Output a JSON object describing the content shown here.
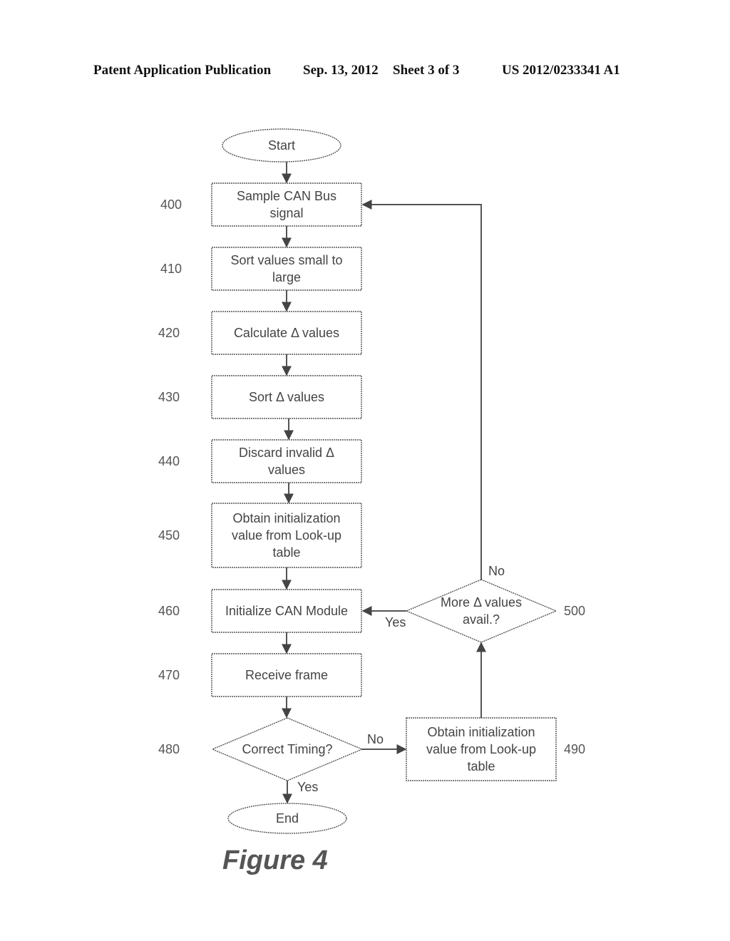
{
  "header": {
    "publication": "Patent Application Publication",
    "date": "Sep. 13, 2012",
    "sheet": "Sheet 3 of 3",
    "number": "US 2012/0233341 A1"
  },
  "figure": {
    "caption": "Figure 4",
    "nodes": [
      {
        "id": "start",
        "type": "terminal",
        "ref": "",
        "lines": [
          "Start"
        ]
      },
      {
        "id": "n400",
        "type": "process",
        "ref": "400",
        "lines": [
          "Sample CAN Bus",
          "signal"
        ]
      },
      {
        "id": "n410",
        "type": "process",
        "ref": "410",
        "lines": [
          "Sort values small to",
          "large"
        ]
      },
      {
        "id": "n420",
        "type": "process",
        "ref": "420",
        "lines": [
          "Calculate Δ values"
        ]
      },
      {
        "id": "n430",
        "type": "process",
        "ref": "430",
        "lines": [
          "Sort Δ values"
        ]
      },
      {
        "id": "n440",
        "type": "process",
        "ref": "440",
        "lines": [
          "Discard invalid Δ",
          "values"
        ]
      },
      {
        "id": "n450",
        "type": "process",
        "ref": "450",
        "lines": [
          "Obtain initialization",
          "value from Look-up",
          "table"
        ]
      },
      {
        "id": "n460",
        "type": "process",
        "ref": "460",
        "lines": [
          "Initialize CAN Module"
        ]
      },
      {
        "id": "n470",
        "type": "process",
        "ref": "470",
        "lines": [
          "Receive frame"
        ]
      },
      {
        "id": "n480",
        "type": "decision",
        "ref": "480",
        "lines": [
          "Correct Timing?"
        ]
      },
      {
        "id": "n490",
        "type": "process",
        "ref": "490",
        "lines": [
          "Obtain initialization",
          "value from Look-up",
          "table"
        ]
      },
      {
        "id": "n500",
        "type": "decision",
        "ref": "500",
        "lines": [
          "More Δ values",
          "avail.?"
        ]
      },
      {
        "id": "end",
        "type": "terminal",
        "ref": "",
        "lines": [
          "End"
        ]
      }
    ],
    "edges": [
      {
        "from": "start",
        "to": "n400",
        "label": ""
      },
      {
        "from": "n400",
        "to": "n410",
        "label": ""
      },
      {
        "from": "n410",
        "to": "n420",
        "label": ""
      },
      {
        "from": "n420",
        "to": "n430",
        "label": ""
      },
      {
        "from": "n430",
        "to": "n440",
        "label": ""
      },
      {
        "from": "n440",
        "to": "n450",
        "label": ""
      },
      {
        "from": "n450",
        "to": "n460",
        "label": ""
      },
      {
        "from": "n460",
        "to": "n470",
        "label": ""
      },
      {
        "from": "n470",
        "to": "n480",
        "label": ""
      },
      {
        "from": "n480",
        "to": "end",
        "label": "Yes"
      },
      {
        "from": "n480",
        "to": "n490",
        "label": "No"
      },
      {
        "from": "n490",
        "to": "n500",
        "label": ""
      },
      {
        "from": "n500",
        "to": "n460",
        "label": "Yes"
      },
      {
        "from": "n500",
        "to": "n400",
        "label": "No"
      }
    ]
  }
}
